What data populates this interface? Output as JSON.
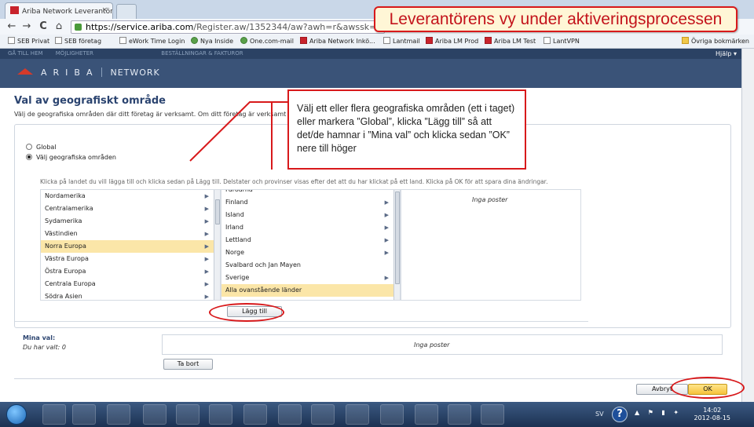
{
  "browser": {
    "tab_title": "Ariba Network Leverantör",
    "tab_close": "×",
    "url_host": "https://service.ariba.com",
    "url_path": "/Register.aw/1352344/aw?awh=r&awssk=bGmC5zxY&a",
    "nav_back": "←",
    "nav_forward": "→",
    "nav_reload": "C",
    "nav_home": "⌂"
  },
  "bookmarks": {
    "items": [
      {
        "label": "SEB Privat",
        "icon": "page-icon"
      },
      {
        "label": "SEB företag",
        "icon": "page-icon"
      },
      {
        "label": "eWork Time Login",
        "icon": "page-icon"
      },
      {
        "label": "Nya Inside",
        "icon": "link-icon"
      },
      {
        "label": "One.com-mail",
        "icon": "globe-icon"
      },
      {
        "label": "Ariba Network Inkö...",
        "icon": "ariba-icon"
      },
      {
        "label": "Lantmail",
        "icon": "page-icon"
      },
      {
        "label": "Ariba LM Prod",
        "icon": "ariba-icon"
      },
      {
        "label": "Ariba LM Test",
        "icon": "ariba-icon"
      },
      {
        "label": "LantVPN",
        "icon": "page-icon"
      }
    ],
    "other": "Övriga bokmärken"
  },
  "callout_title": "Leverantörens vy under aktiveringsprocessen",
  "ariba": {
    "nav_items": [
      "GÅ TILL HEM",
      "MÖJLIGHETER",
      "BESTÄLLNINGAR & FAKTUROR"
    ],
    "help": "Hjälp ▾",
    "logo_text": "ARIBA",
    "logo_network": "NETWORK"
  },
  "page": {
    "title": "Val av geografiskt område",
    "description": "Välj de geografiska områden där ditt företag är verksamt. Om ditt företag är verksamt",
    "radio_global": "Global",
    "radio_select": "Välj geografiska områden",
    "instruction": "Klicka på landet du vill lägga till och klicka sedan på Lägg till. Delstater och provinser visas efter det att du har klickat på ett land. Klicka på OK för att spara dina ändringar.",
    "regions": [
      "Nordamerika",
      "Centralamerika",
      "Sydamerika",
      "Västindien",
      "Norra Europa",
      "Västra Europa",
      "Östra Europa",
      "Centrala Europa",
      "Södra Asien"
    ],
    "countries": [
      "Färöarna",
      "Finland",
      "Island",
      "Irland",
      "Lettland",
      "Norge",
      "Svalbard och Jan Mayen",
      "Sverige",
      "Alla ovanstående länder"
    ],
    "no_entries": "Inga poster",
    "add_button": "Lägg till",
    "selected_label": "Mina val:",
    "selected_count": "Du har valt: 0",
    "remove_button": "Ta bort",
    "cancel_button": "Avbryt",
    "ok_button": "OK"
  },
  "annotation": {
    "text": "Välj ett eller flera geografiska områden (ett i taget) eller markera ”Global”, klicka ”Lägg till” så att det/de hamnar i ”Mina val” och klicka sedan ”OK” nere till höger"
  },
  "taskbar": {
    "lang": "SV",
    "time": "14:02",
    "date": "2012-08-15"
  },
  "colors": {
    "annotation_red": "#d8191b",
    "ariba_header": "#3a5378",
    "selected_row": "#fbe6a8",
    "ok_button": "#f6c23b"
  }
}
